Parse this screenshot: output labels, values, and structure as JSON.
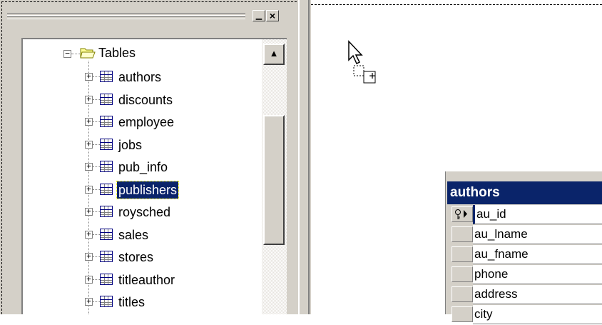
{
  "pane": {
    "minimize_label": "▁",
    "close_label": "×",
    "tree": {
      "root_expander": "−",
      "root_label": "Tables",
      "items": [
        {
          "label": "authors",
          "selected": false
        },
        {
          "label": "discounts",
          "selected": false
        },
        {
          "label": "employee",
          "selected": false
        },
        {
          "label": "jobs",
          "selected": false
        },
        {
          "label": "pub_info",
          "selected": false
        },
        {
          "label": "publishers",
          "selected": true
        },
        {
          "label": "roysched",
          "selected": false
        },
        {
          "label": "sales",
          "selected": false
        },
        {
          "label": "stores",
          "selected": false
        },
        {
          "label": "titleauthor",
          "selected": false
        },
        {
          "label": "titles",
          "selected": false
        }
      ],
      "expander_symbol": "+"
    },
    "scrollbar": {
      "up_arrow": "▲"
    }
  },
  "canvas": {
    "drag_cursor_plus": "+",
    "table": {
      "title": "authors",
      "key_icon": "key-icon",
      "columns": [
        "au_id",
        "au_lname",
        "au_fname",
        "phone",
        "address",
        "city"
      ]
    }
  },
  "colors": {
    "selection": "#0a246a",
    "face": "#d4d0c8",
    "title_bar": "#0a246a"
  }
}
